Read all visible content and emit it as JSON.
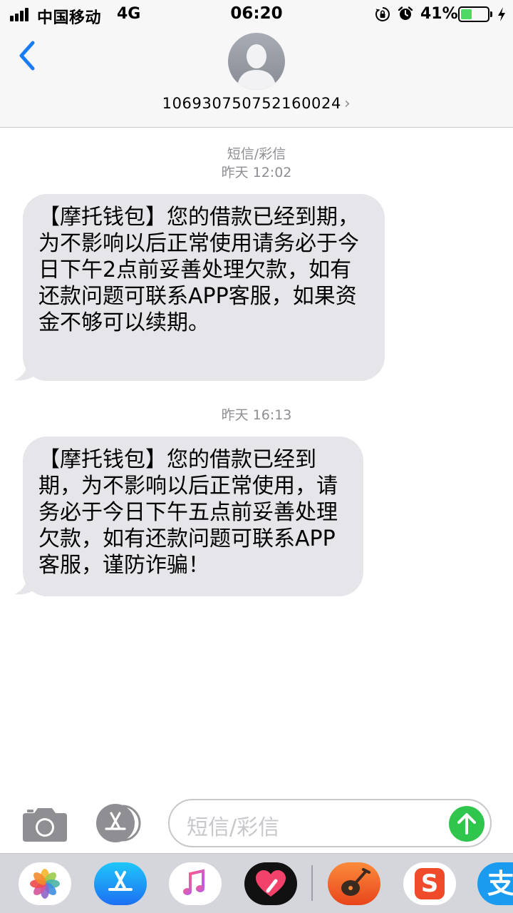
{
  "status_bar": {
    "carrier": "中国移动",
    "network": "4G",
    "time": "06:20",
    "battery_percent": "41%",
    "battery_level": 0.41,
    "battery_color": "#4cd964"
  },
  "header": {
    "contact": "106930750752160024",
    "contact_chevron": "›",
    "icons": {
      "back": "chevron-left-icon",
      "avatar": "person-silhouette-icon"
    }
  },
  "messages": [
    {
      "type_label": "短信/彩信",
      "timestamp": "昨天 12:02",
      "text": "【摩托钱包】您的借款已经到期，为不影响以后正常使用请务必于今日下午2点前妥善处理欠款，如有还款问题可联系APP客服，如果资金不够可以续期。"
    },
    {
      "timestamp": "昨天 16:13",
      "text": "【摩托钱包】您的借款已经到期，为不影响以后正常使用，请务必于今日下午五点前妥善处理欠款，如有还款问题可联系APP客服，谨防诈骗！"
    }
  ],
  "input_bar": {
    "placeholder": "短信/彩信",
    "icons": {
      "camera": "camera-icon",
      "apps": "app-store-icon",
      "send": "send-arrow-icon"
    },
    "send_color": "#30c54c"
  },
  "app_drawer": {
    "apps": [
      "photos-icon",
      "app-store-icon",
      "music-icon",
      "digital-touch-icon",
      "garageband-icon",
      "sogou-icon",
      "alipay-icon"
    ],
    "sogou_glyph": "S",
    "alipay_glyph": "支"
  },
  "colors": {
    "bubble_bg": "#e5e5ea",
    "ios_blue": "#1a7cf5",
    "timestamp_gray": "#8e8e93"
  }
}
